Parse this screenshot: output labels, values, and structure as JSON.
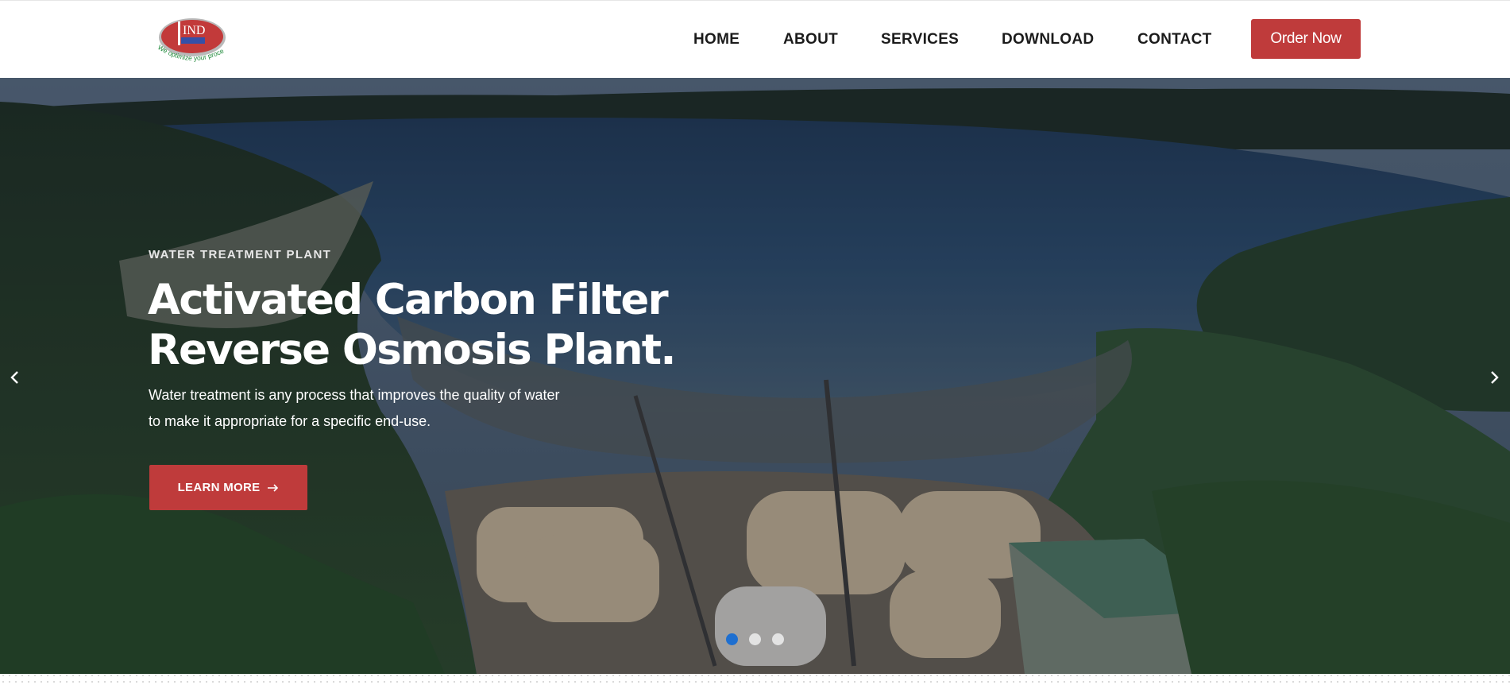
{
  "brand": {
    "logo_text": "IND",
    "logo_tagline": "We optimize your process"
  },
  "nav": {
    "items": [
      "HOME",
      "ABOUT",
      "SERVICES",
      "DOWNLOAD",
      "CONTACT"
    ],
    "order_label": "Order Now"
  },
  "hero": {
    "eyebrow": "WATER TREATMENT PLANT",
    "title_line1": "Activated Carbon Filter",
    "title_line2": "Reverse Osmosis Plant.",
    "description": "Water treatment is any process that improves the quality of water to make it appropriate for a specific end-use.",
    "cta_label": "LEARN MORE",
    "cta_icon": "arrow-right-icon",
    "slides_total": 3,
    "active_slide": 1
  },
  "colors": {
    "accent": "#bf3b3b",
    "dot_active": "#1e6fd0",
    "dot_inactive": "#e3e3e3",
    "nav_text": "#1b1b1b"
  }
}
